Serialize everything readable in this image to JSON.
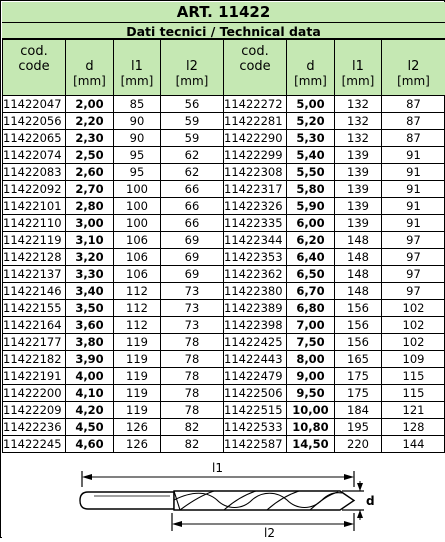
{
  "title": "ART. 11422",
  "subtitle": "Dati tecnici / Technical data",
  "headers": [
    {
      "label1": "cod.",
      "label2": "code"
    },
    {
      "label": "d",
      "unit": "[mm]"
    },
    {
      "label": "l1",
      "unit": "[mm]"
    },
    {
      "label": "l2",
      "unit": "[mm]"
    }
  ],
  "rows": [
    [
      [
        "11422047",
        "2,00",
        "85",
        "56"
      ],
      [
        "11422272",
        "5,00",
        "132",
        "87"
      ]
    ],
    [
      [
        "11422056",
        "2,20",
        "90",
        "59"
      ],
      [
        "11422281",
        "5,20",
        "132",
        "87"
      ]
    ],
    [
      [
        "11422065",
        "2,30",
        "90",
        "59"
      ],
      [
        "11422290",
        "5,30",
        "132",
        "87"
      ]
    ],
    [
      [
        "11422074",
        "2,50",
        "95",
        "62"
      ],
      [
        "11422299",
        "5,40",
        "139",
        "91"
      ]
    ],
    [
      [
        "11422083",
        "2,60",
        "95",
        "62"
      ],
      [
        "11422308",
        "5,50",
        "139",
        "91"
      ]
    ],
    [
      [
        "11422092",
        "2,70",
        "100",
        "66"
      ],
      [
        "11422317",
        "5,80",
        "139",
        "91"
      ]
    ],
    [
      [
        "11422101",
        "2,80",
        "100",
        "66"
      ],
      [
        "11422326",
        "5,90",
        "139",
        "91"
      ]
    ],
    [
      [
        "11422110",
        "3,00",
        "100",
        "66"
      ],
      [
        "11422335",
        "6,00",
        "139",
        "91"
      ]
    ],
    [
      [
        "11422119",
        "3,10",
        "106",
        "69"
      ],
      [
        "11422344",
        "6,20",
        "148",
        "97"
      ]
    ],
    [
      [
        "11422128",
        "3,20",
        "106",
        "69"
      ],
      [
        "11422353",
        "6,40",
        "148",
        "97"
      ]
    ],
    [
      [
        "11422137",
        "3,30",
        "106",
        "69"
      ],
      [
        "11422362",
        "6,50",
        "148",
        "97"
      ]
    ],
    [
      [
        "11422146",
        "3,40",
        "112",
        "73"
      ],
      [
        "11422380",
        "6,70",
        "148",
        "97"
      ]
    ],
    [
      [
        "11422155",
        "3,50",
        "112",
        "73"
      ],
      [
        "11422389",
        "6,80",
        "156",
        "102"
      ]
    ],
    [
      [
        "11422164",
        "3,60",
        "112",
        "73"
      ],
      [
        "11422398",
        "7,00",
        "156",
        "102"
      ]
    ],
    [
      [
        "11422177",
        "3,80",
        "119",
        "78"
      ],
      [
        "11422425",
        "7,50",
        "156",
        "102"
      ]
    ],
    [
      [
        "11422182",
        "3,90",
        "119",
        "78"
      ],
      [
        "11422443",
        "8,00",
        "165",
        "109"
      ]
    ],
    [
      [
        "11422191",
        "4,00",
        "119",
        "78"
      ],
      [
        "11422479",
        "9,00",
        "175",
        "115"
      ]
    ],
    [
      [
        "11422200",
        "4,10",
        "119",
        "78"
      ],
      [
        "11422506",
        "9,50",
        "175",
        "115"
      ]
    ],
    [
      [
        "11422209",
        "4,20",
        "119",
        "78"
      ],
      [
        "11422515",
        "10,00",
        "184",
        "121"
      ]
    ],
    [
      [
        "11422236",
        "4,50",
        "126",
        "82"
      ],
      [
        "11422533",
        "10,80",
        "195",
        "128"
      ]
    ],
    [
      [
        "11422245",
        "4,60",
        "126",
        "82"
      ],
      [
        "11422587",
        "14,50",
        "220",
        "144"
      ]
    ]
  ],
  "diagram": {
    "label_l1": "l1",
    "label_l2": "l2",
    "label_d": "d",
    "stroke_color": "#000000"
  },
  "colors": {
    "header_bg": "#c5e8b3",
    "border": "#000000"
  }
}
